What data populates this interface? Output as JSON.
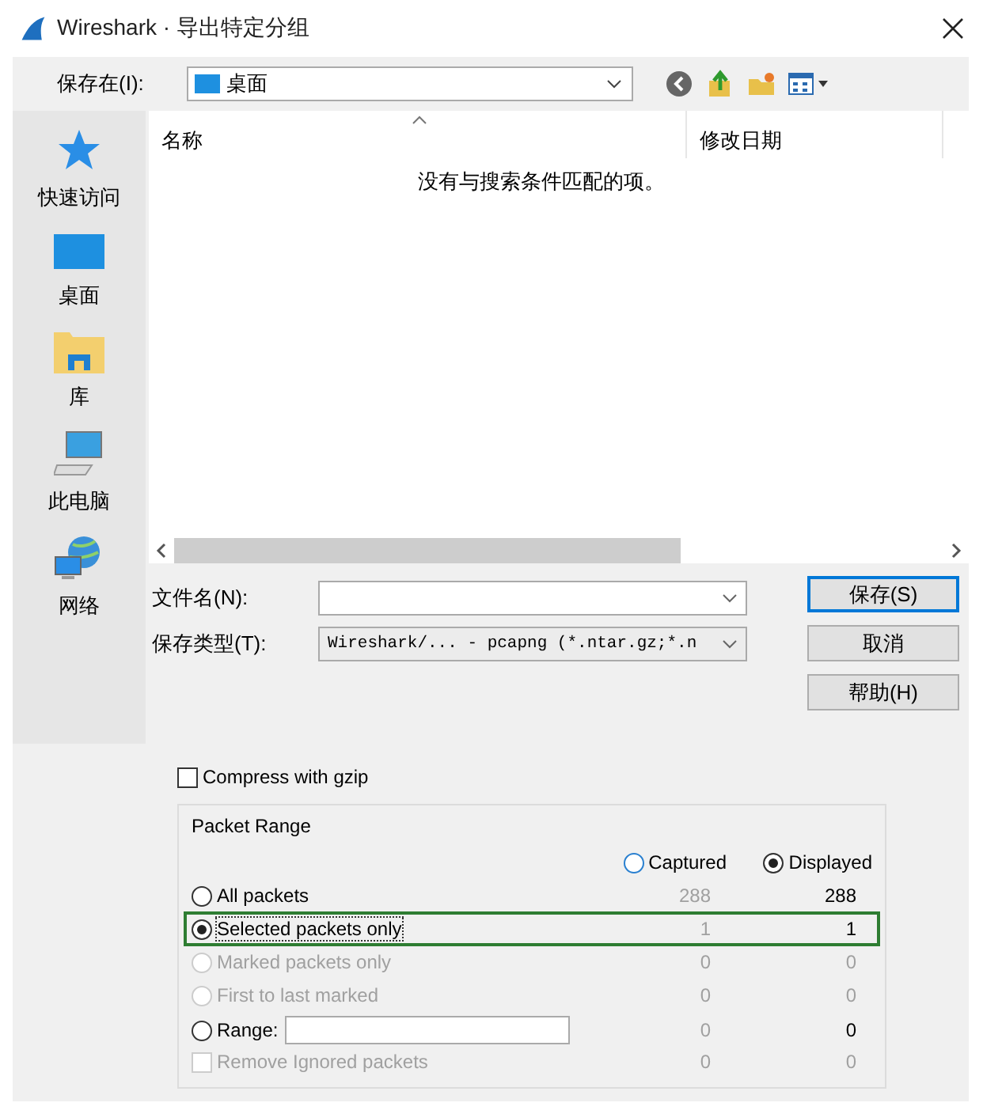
{
  "window": {
    "title": "Wireshark · 导出特定分组"
  },
  "location": {
    "label": "保存在(I):",
    "value": "桌面"
  },
  "sidebar": {
    "items": [
      {
        "label": "快速访问"
      },
      {
        "label": "桌面"
      },
      {
        "label": "库"
      },
      {
        "label": "此电脑"
      },
      {
        "label": "网络"
      }
    ]
  },
  "file_list": {
    "columns": [
      "名称",
      "修改日期"
    ],
    "empty_message": "没有与搜索条件匹配的项。"
  },
  "filename": {
    "label": "文件名(N):"
  },
  "filetype": {
    "label": "保存类型(T):",
    "value": "Wireshark/... - pcapng (*.ntar.gz;*.n"
  },
  "buttons": [
    {
      "label": "保存(S)",
      "default": true
    },
    {
      "label": "取消",
      "default": false
    },
    {
      "label": "帮助(H)",
      "default": false
    }
  ],
  "compress": {
    "label": "Compress with gzip",
    "checked": false
  },
  "packet_range": {
    "title": "Packet Range",
    "sources": [
      {
        "label": "Captured",
        "selected": false
      },
      {
        "label": "Displayed",
        "selected": true
      }
    ],
    "rows": [
      {
        "kind": "radio",
        "label": "All packets",
        "selected": false,
        "disabled": false,
        "highlighted": false,
        "captured": "288",
        "displayed": "288"
      },
      {
        "kind": "radio",
        "label": "Selected packets only",
        "selected": true,
        "disabled": false,
        "highlighted": true,
        "captured": "1",
        "displayed": "1"
      },
      {
        "kind": "radio",
        "label": "Marked packets only",
        "selected": false,
        "disabled": true,
        "highlighted": false,
        "captured": "0",
        "displayed": "0"
      },
      {
        "kind": "radio",
        "label": "First to last marked",
        "selected": false,
        "disabled": true,
        "highlighted": false,
        "captured": "0",
        "displayed": "0"
      },
      {
        "kind": "range",
        "label": "Range:",
        "selected": false,
        "disabled": false,
        "highlighted": false,
        "captured": "0",
        "displayed": "0"
      },
      {
        "kind": "checkbox",
        "label": "Remove Ignored packets",
        "checked": false,
        "disabled": true,
        "highlighted": false,
        "captured": "0",
        "displayed": "0"
      }
    ]
  }
}
